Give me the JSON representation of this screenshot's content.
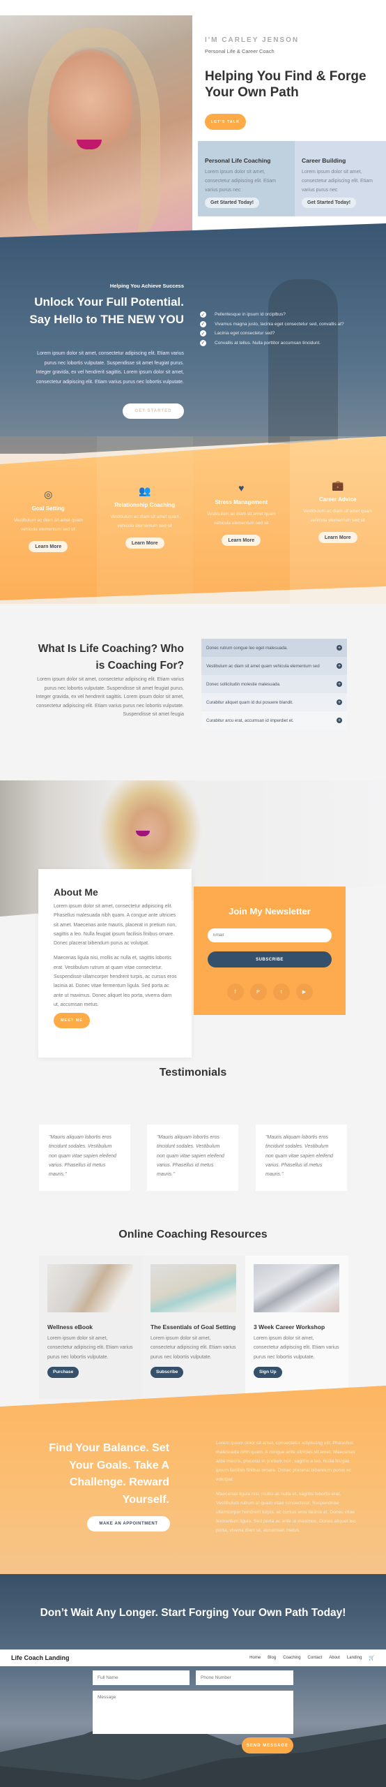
{
  "hero": {
    "kicker": "I'M CARLEY JENSON",
    "subtitle": "Personal Life & Career Coach",
    "title": "Helping You Find & Forge Your Own Path",
    "cta": "LET'S TALK",
    "services": [
      {
        "title": "Personal Life Coaching",
        "text": "Lorem ipsum dolor sit amet, consectetur adipiscing elit. Etiam varius purus nec",
        "button": "Get Started Today!"
      },
      {
        "title": "Career Building",
        "text": "Lorem ipsum dolor sit amet, consectetur adipiscing elit. Etiam varius purus nec",
        "button": "Get Started Today!"
      }
    ]
  },
  "success": {
    "kicker": "Helping You Achieve Success",
    "title": "Unlock Your Full Potential. Say Hello to THE NEW YOU",
    "text": "Lorem ipsum dolor sit amet, consectetur adipiscing elit. Etiam varius purus nec lobortis vulputate. Suspendisse sit amet feugiat purus. Integer gravida, ex vel hendrerit sagittis. Lorem ipsum dolor sit amet, consectetur adipiscing elit. Etiam varius purus nec lobortis vulputate.",
    "button": "GET STARTED",
    "checklist": [
      "Pellentesque in ipsum id orciplbus?",
      "Vivamus magna justo, lacinia eget consectetur sed, convallis at?",
      "Lacinia eget consectetur sed?",
      "Convallis at tellus. Nulla porttitor accumsan tincidunt."
    ]
  },
  "services": [
    {
      "icon": "target-icon",
      "glyph": "◎",
      "title": "Goal Setting",
      "text": "Vestibulum ac diam sit amet quam vehicula elementum sed sit",
      "button": "Learn More"
    },
    {
      "icon": "users-icon",
      "glyph": "👥",
      "title": "Relationship Coaching",
      "text": "Vestibulum ac diam sit amet quam vehicula elementum sed sit",
      "button": "Learn More"
    },
    {
      "icon": "heart-icon",
      "glyph": "♥",
      "title": "Stress Management",
      "text": "Vestibulum ac diam sit amet quam vehicula elementum sed sit",
      "button": "Learn More"
    },
    {
      "icon": "briefcase-icon",
      "glyph": "💼",
      "title": "Career Advice",
      "text": "Vestibulum ac diam sit amet quam vehicula elementum sed sit",
      "button": "Learn More"
    }
  ],
  "what": {
    "title": "What Is Life Coaching? Who is Coaching For?",
    "text": "Lorem ipsum dolor sit amet, consectetur adipiscing elit. Etiam varius purus nec lobortis vulputate. Suspendisse sit amet feugiat purus. Integer gravida, ex vel hendrerit sagittis. Lorem ipsum dolor sit amet, consectetur adipiscing elit. Etiam varius purus nec lobortis vulputate. Suspendisse sit amet feugia",
    "accordion": [
      "Donec rutrum congue leo eget malesuada.",
      "Vestibulum ac diam sit amet quam vehicula elementum sed",
      "Donec sollicitudin molestie malesuada.",
      "Curabitur aliquet quam id dui posuere blandit.",
      "Curabitur arcu erat, accumsan id imperdiet et."
    ]
  },
  "about": {
    "title": "About Me",
    "p1": "Lorem ipsum dolor sit amet, consectetur adipiscing elit. Phasellus malesuada nibh quam. A congue ante ultricies sit amet. Maecenas ante mauris, placerat in pretium non, sagittis a leo. Nulla feugiat ipsum facilisis finibus ornare. Donec placerat bibendum purus ac volutpat.",
    "p2": "Maecenas ligula nisi, mollis ac nulla et, sagittis lobortis erat. Vestibulum rutrum at quam vitae consectetur. Suspendisse ullamcorper hendrerit turpis, ac cursus eros lacinia at. Donec vitae fermentum ligula. Sed porta ac ante ut maximus. Donec aliquet leo porta, viverra diam ut, accumsan metus.",
    "button": "MEET ME"
  },
  "newsletter": {
    "title": "Join My Newsletter",
    "email_placeholder": "Email",
    "button": "SUBSCRIBE",
    "socials": [
      {
        "icon": "facebook-icon",
        "glyph": "f"
      },
      {
        "icon": "pinterest-icon",
        "glyph": "P"
      },
      {
        "icon": "twitter-icon",
        "glyph": "t"
      },
      {
        "icon": "youtube-icon",
        "glyph": "▶"
      }
    ]
  },
  "testimonials": {
    "title": "Testimonials",
    "items": [
      "\"Mauris aliquam lobortis eros tincidunt sodales. Vestibulum non quam vitae sapien eleifend varius. Phasellus id metus mauris.\"",
      "\"Mauris aliquam lobortis eros tincidunt sodales. Vestibulum non quam vitae sapien eleifend varius. Phasellus id metus mauris.\"",
      "\"Mauris aliquam lobortis eros tincidunt sodales. Vestibulum non quam vitae sapien eleifend varius. Phasellus id metus mauris.\""
    ]
  },
  "resources": {
    "title": "Online Coaching Resources",
    "items": [
      {
        "title": "Wellness eBook",
        "text": "Lorem ipsum dolor sit amet, consectetur adipiscing elit. Etiam varius purus nec lobortis vulputate.",
        "button": "Purchase"
      },
      {
        "title": "The Essentials of Goal Setting",
        "text": "Lorem ipsum dolor sit amet, consectetur adipiscing elit. Etiam varius purus nec lobortis vulputate.",
        "button": "Subscribe"
      },
      {
        "title": "3 Week Career Workshop",
        "text": "Lorem ipsum dolor sit amet, consectetur adipiscing elit. Etiam varius purus nec lobortis vulputate.",
        "button": "Sign Up"
      }
    ]
  },
  "balance": {
    "title": "Find Your Balance. Set Your Goals. Take A Challenge. Reward Yourself.",
    "button": "MAKE AN APPOINTMENT",
    "p1": "Lorem ipsum dolor sit amet, consectetur adipiscing elit. Phasellus malesuada nibh quam. A congue ante ultricies sit amet. Maecenas ante mauris, placerat in pretium non, sagittis a leo. Nulla feugiat ipsum facilisis finibus ornare. Donec placerat bibendum purus ac volutpat.",
    "p2": "Maecenas ligula nisi, mollis ac nulla et, sagittis lobortis erat. Vestibulum rutrum at quam vitae consectetur. Suspendisse ullamcorper hendrerit turpis, ac cursus eros lacinia at. Donec vitae fermentum ligula. Sed porta ac ante ut maximus. Donec aliquet leo porta, viverra diam ut, accumsan metus."
  },
  "contact": {
    "title": "Don’t Wait Any Longer. Start Forging Your Own Path Today!",
    "name_placeholder": "Full Name",
    "phone_placeholder": "Phone Number",
    "message_placeholder": "Message",
    "button": "SEND MESSAGE"
  },
  "navbar": {
    "logo": "Life Coach Landing",
    "links": [
      "Home",
      "Blog",
      "Coaching",
      "Contact",
      "About",
      "Landing"
    ],
    "cart_icon": "🛒"
  },
  "colors": {
    "accent_orange": "#fdaa47",
    "navy": "#34506a"
  }
}
